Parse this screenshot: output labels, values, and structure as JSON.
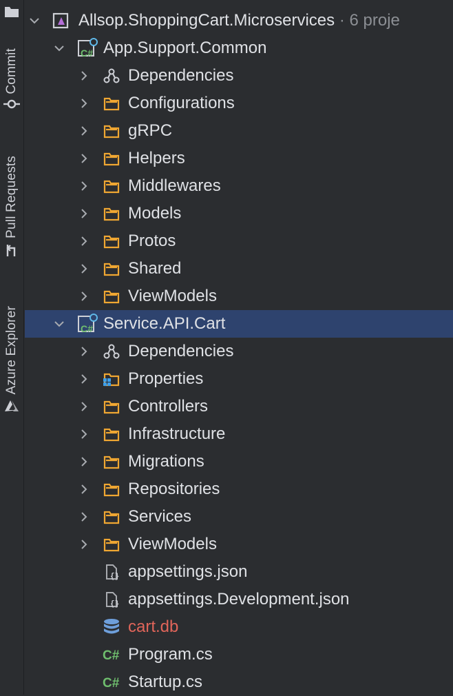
{
  "sidebar": {
    "tabs": [
      {
        "label": "Commit",
        "icon": "commit-icon"
      },
      {
        "label": "Pull Requests",
        "icon": "pull-request-icon"
      },
      {
        "label": "Azure Explorer",
        "icon": "azure-icon"
      }
    ]
  },
  "tree": {
    "solution": {
      "label": "Allsop.ShoppingCart.Microservices",
      "suffix": " · 6 proje"
    },
    "project1": {
      "label": "App.Support.Common",
      "items": [
        "Dependencies",
        "Configurations",
        "gRPC",
        "Helpers",
        "Middlewares",
        "Models",
        "Protos",
        "Shared",
        "ViewModels"
      ]
    },
    "project2": {
      "label": "Service.API.Cart",
      "items": [
        "Dependencies",
        "Properties",
        "Controllers",
        "Infrastructure",
        "Migrations",
        "Repositories",
        "Services",
        "ViewModels"
      ],
      "files": [
        "appsettings.json",
        "appsettings.Development.json",
        "cart.db",
        "Program.cs",
        "Startup.cs"
      ]
    }
  },
  "colors": {
    "background": "#2b2d30",
    "selection": "#2e436e",
    "folder": "#f0a732",
    "csharp": "#6fbe6e",
    "db_text": "#e0655a"
  }
}
